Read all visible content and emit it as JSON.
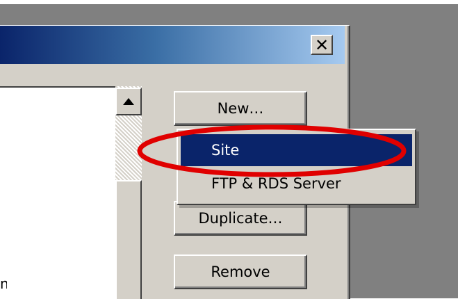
{
  "dialog": {
    "close_glyph": "✕",
    "list": {
      "partial_text": "n"
    },
    "buttons": {
      "new": "New…",
      "duplicate": "Duplicate…",
      "remove": "Remove"
    }
  },
  "menu": {
    "items": [
      {
        "label": "Site",
        "selected": true
      },
      {
        "label": "FTP & RDS Server",
        "selected": false
      }
    ]
  },
  "annotation": {
    "color": "#e00000"
  }
}
